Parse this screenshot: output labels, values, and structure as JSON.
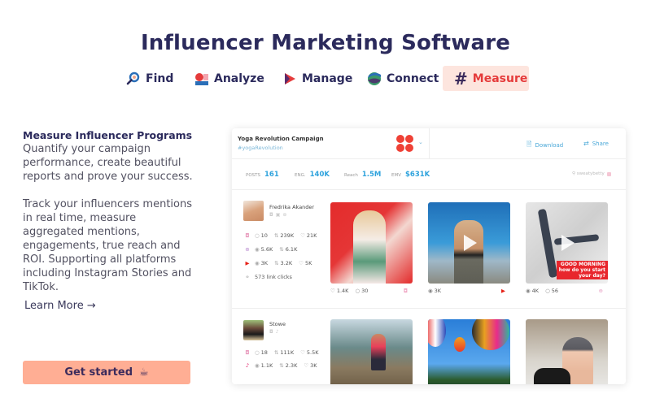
{
  "page": {
    "title": "Influencer Marketing Software"
  },
  "nav": {
    "items": [
      {
        "label": "Find",
        "icon": "magnifier-icon"
      },
      {
        "label": "Analyze",
        "icon": "chart-icon"
      },
      {
        "label": "Manage",
        "icon": "play-flag-icon"
      },
      {
        "label": "Connect",
        "icon": "globe-icon"
      },
      {
        "label": "Measure",
        "icon": "hashtag-icon",
        "active": true
      }
    ]
  },
  "left": {
    "heading": "Measure Influencer Programs",
    "intro": "Quantify your campaign performance, create beautiful reports and prove your success.",
    "body": "Track your influencers mentions in real time, measure aggregated mentions, engagements, true reach and ROI. Supporting all platforms including Instagram Stories and TikTok.",
    "learn_more": "Learn More",
    "learn_more_arrow": "→",
    "cta": "Get started",
    "cta_icon": "☕"
  },
  "dashboard": {
    "campaign_name": "Yoga Revolution Campaign",
    "campaign_tag": "#yogaRevolution",
    "chevron": "⌄",
    "download_label": "Download",
    "share_label": "Share",
    "stats": [
      {
        "label": "POSTS",
        "value": "161"
      },
      {
        "label": "ENG.",
        "value": "140K"
      },
      {
        "label": "Reach",
        "value": "1.5M"
      },
      {
        "label": "EMV",
        "value": "$631K"
      }
    ],
    "filter_label": "sweatybetty",
    "influencers": [
      {
        "name": "Fredrika Akander",
        "metrics": [
          {
            "platform": "instagram",
            "values": [
              {
                "icon": "comment",
                "v": "10"
              },
              {
                "icon": "share",
                "v": "239K"
              },
              {
                "icon": "heart",
                "v": "21K"
              }
            ]
          },
          {
            "platform": "stories",
            "values": [
              {
                "icon": "eye",
                "v": "5.6K"
              },
              {
                "icon": "share",
                "v": "6.1K"
              }
            ]
          },
          {
            "platform": "youtube",
            "values": [
              {
                "icon": "eye",
                "v": "3K"
              },
              {
                "icon": "share",
                "v": "3.2K"
              },
              {
                "icon": "heart",
                "v": "5K"
              }
            ]
          }
        ],
        "link_clicks": "573 link clicks",
        "posts": [
          {
            "likes": "1.4K",
            "comments": "30",
            "platform": "instagram"
          },
          {
            "views": "3K",
            "platform": "youtube",
            "video": true
          },
          {
            "views": "4K",
            "comments": "56",
            "platform": "stories",
            "video": true,
            "overlay": [
              "GOOD MORNING",
              "how do you start",
              "your day?"
            ]
          }
        ]
      },
      {
        "name": "Stowe",
        "metrics": [
          {
            "platform": "instagram",
            "values": [
              {
                "icon": "comment",
                "v": "18"
              },
              {
                "icon": "share",
                "v": "111K"
              },
              {
                "icon": "heart",
                "v": "5.5K"
              }
            ]
          },
          {
            "platform": "tiktok",
            "values": [
              {
                "icon": "eye",
                "v": "1.1K"
              },
              {
                "icon": "share",
                "v": "2.3K"
              },
              {
                "icon": "heart",
                "v": "3K"
              }
            ]
          }
        ]
      }
    ]
  },
  "colors": {
    "brand_navy": "#2b2a5c",
    "accent_red": "#e53b3b",
    "active_tab_bg": "#fde5de",
    "cta_bg": "#ffae94",
    "stat_blue": "#2fa3dd"
  }
}
